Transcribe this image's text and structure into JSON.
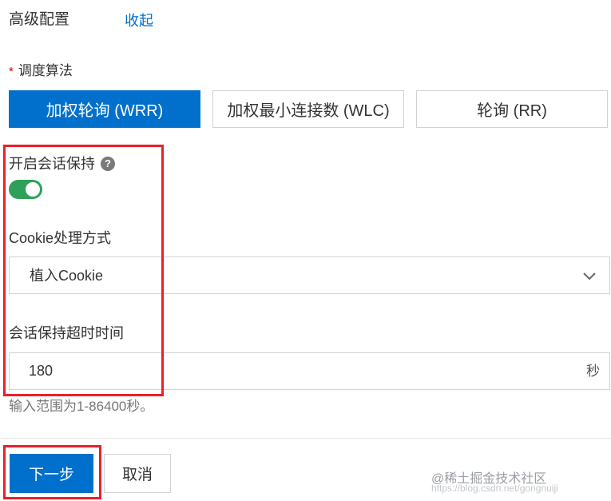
{
  "header": {
    "title": "高级配置",
    "collapse_label": "收起"
  },
  "algorithm": {
    "required_mark": "*",
    "label": "调度算法",
    "options": [
      {
        "label": "加权轮询 (WRR)",
        "selected": true
      },
      {
        "label": "加权最小连接数 (WLC)",
        "selected": false
      },
      {
        "label": "轮询 (RR)",
        "selected": false
      }
    ]
  },
  "session": {
    "label": "开启会话保持",
    "help_icon": "?",
    "enabled": true
  },
  "cookie": {
    "label": "Cookie处理方式",
    "selected": "植入Cookie"
  },
  "timeout": {
    "label": "会话保持超时时间",
    "value": "180",
    "unit": "秒",
    "hint": "输入范围为1-86400秒。"
  },
  "footer": {
    "next_label": "下一步",
    "cancel_label": "取消"
  },
  "watermark": {
    "text": "@稀土掘金技术社区",
    "sub_text": "https://blog.csdn.net/gongnuiji"
  },
  "colors": {
    "primary": "#0070cc",
    "toggle_on": "#2ea05a",
    "highlight": "#e8202a",
    "required": "#e00000"
  }
}
